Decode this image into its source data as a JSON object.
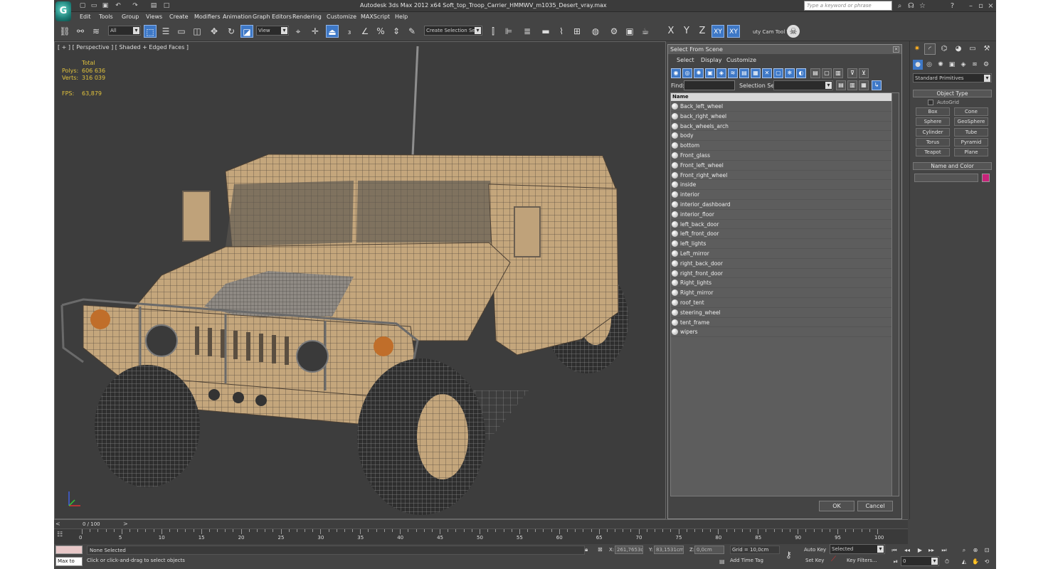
{
  "app": {
    "window_title": "Autodesk 3ds Max  2012 x64     Soft_top_Troop_Carrier_HMMWV_m1035_Desert_vray.max",
    "search_placeholder": "Type a keyword or phrase"
  },
  "menu": [
    "Edit",
    "Tools",
    "Group",
    "Views",
    "Create",
    "Modifiers",
    "Animation",
    "Graph Editors",
    "Rendering",
    "Customize",
    "MAXScript",
    "Help"
  ],
  "toolbar": {
    "filter_value": "All",
    "refcoord_value": "View",
    "selection_set_value": "Create Selection Se",
    "axis_x": "X",
    "axis_y": "Y",
    "axis_z": "Z",
    "axis_xy": "XY",
    "axis_xy2": "XY",
    "plugin_label": "uty Cam Tool \\"
  },
  "viewport": {
    "label": "[ + ] [ Perspective ] [ Shaded + Edged Faces ]",
    "stats_total": "Total",
    "polys_label": "Polys:",
    "polys_value": "606 636",
    "verts_label": "Verts:",
    "verts_value": "316 039",
    "fps_label": "FPS:",
    "fps_value": "63,879"
  },
  "sfs": {
    "title": "Select From Scene",
    "menu": [
      "Select",
      "Display",
      "Customize"
    ],
    "find_label": "Find:",
    "selset_label": "Selection Set:",
    "column_header": "Name",
    "items": [
      "Back_left_wheel",
      "back_right_wheel",
      "back_wheels_arch",
      "body",
      "bottom",
      "Front_glass",
      "Front_left_wheel",
      "Front_right_wheel",
      "inside",
      "interior",
      "interior_dashboard",
      "interior_floor",
      "left_back_door",
      "left_front_door",
      "left_lights",
      "Left_mirror",
      "right_back_door",
      "right_front_door",
      "Right_lights",
      "Right_mirror",
      "roof_tent",
      "steering_wheel",
      "tent_frame",
      "wipers"
    ],
    "ok_label": "OK",
    "cancel_label": "Cancel"
  },
  "command_panel": {
    "category_value": "Standard Primitives",
    "object_type_label": "Object Type",
    "autogrid_label": "AutoGrid",
    "primitives": [
      "Box",
      "Cone",
      "Sphere",
      "GeoSphere",
      "Cylinder",
      "Tube",
      "Torus",
      "Pyramid",
      "Teapot",
      "Plane"
    ],
    "name_color_label": "Name and Color",
    "color": "#c8237a"
  },
  "timeline": {
    "frame_label": "0 / 100",
    "ticks": [
      "0",
      "5",
      "10",
      "15",
      "20",
      "25",
      "30",
      "35",
      "40",
      "45",
      "50",
      "55",
      "60",
      "65",
      "70",
      "75",
      "80",
      "85",
      "90",
      "95",
      "100"
    ]
  },
  "status": {
    "maxscript": "Max to",
    "selection": "None Selected",
    "prompt": "Click or click-and-drag to select objects",
    "x_label": "X:",
    "x_value": "261,7653c",
    "y_label": "Y:",
    "y_value": "83,1531cm",
    "z_label": "Z:",
    "z_value": "0,0cm",
    "grid": "Grid = 10,0cm",
    "add_time_tag": "Add Time Tag",
    "auto_key": "Auto Key",
    "set_key": "Set Key",
    "selected_value": "Selected",
    "key_filters": "Key Filters...",
    "frame_value": "0"
  }
}
